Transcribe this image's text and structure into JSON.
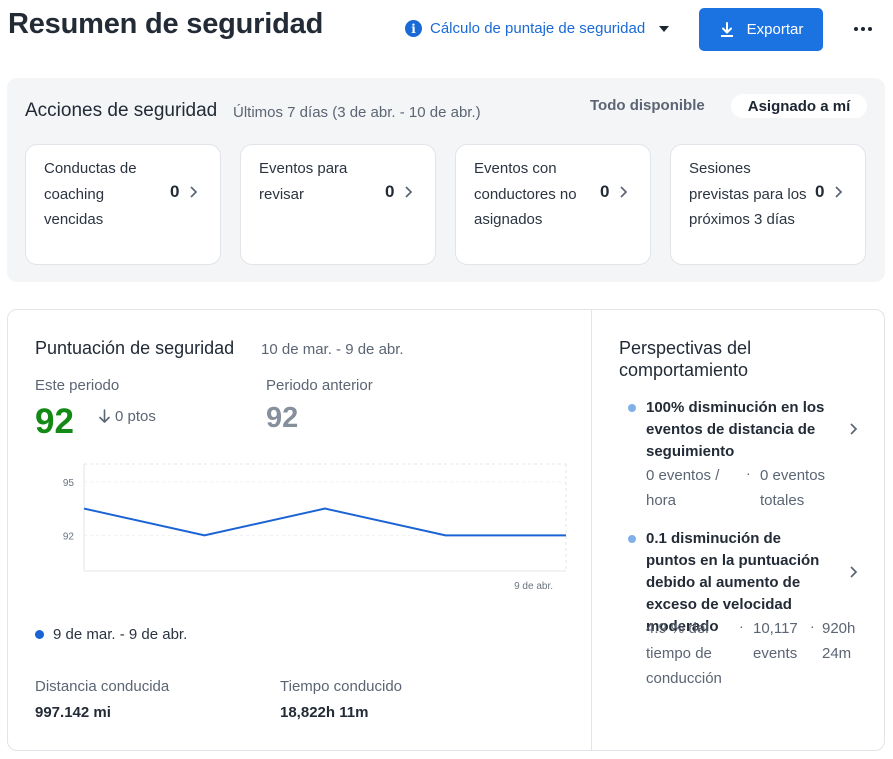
{
  "header": {
    "title": "Resumen de seguridad",
    "score_calc_label": "Cálculo de puntaje de seguridad",
    "export_label": "Exportar",
    "icons": {
      "info": "info-icon",
      "caret": "caret-down-icon",
      "export": "download-icon",
      "more": "more-horizontal-icon"
    }
  },
  "actions": {
    "title": "Acciones de seguridad",
    "range": "Últimos 7 días (3 de abr. - 10 de abr.)",
    "filter_all": "Todo disponible",
    "filter_mine": "Asignado a mí",
    "cards": [
      {
        "label": "Conductas de coaching vencidas",
        "count": "0"
      },
      {
        "label": "Eventos para revisar",
        "count": "0"
      },
      {
        "label": "Eventos con conductores no asignados",
        "count": "0"
      },
      {
        "label": "Sesiones previstas para los próximos 3 días",
        "count": "0"
      }
    ]
  },
  "score": {
    "title": "Puntuación de seguridad",
    "range": "10 de mar. - 9 de abr.",
    "this_period_label": "Este periodo",
    "this_period_value": "92",
    "delta": "0 ptos",
    "prev_period_label": "Periodo anterior",
    "prev_period_value": "92",
    "legend": "9 de mar. - 9 de abr.",
    "distance_label": "Distancia conducida",
    "distance_value": "997.142 mi",
    "time_label": "Tiempo conducido",
    "time_value": "18,822h 11m",
    "colors": {
      "score_good": "#148a16",
      "score_prev": "#86909c",
      "line": "#1a63d4"
    }
  },
  "chart_data": {
    "type": "line",
    "y_ticks": [
      "95",
      "92"
    ],
    "x_tick_labels": [
      "9 de abr."
    ],
    "ylim": [
      90,
      96
    ],
    "series": [
      {
        "name": "9 de mar. - 9 de abr.",
        "values": [
          93.5,
          92,
          93.5,
          92,
          92
        ]
      }
    ]
  },
  "insights": {
    "title": "Perspectivas del comportamiento",
    "items": [
      {
        "text": "100% disminución en los eventos de distancia de seguimiento",
        "metrics": [
          "0 eventos / hora",
          "0 eventos totales"
        ]
      },
      {
        "text": "0.1 disminución de puntos en la puntuación debido al aumento de exceso de velocidad moderado",
        "metrics": [
          "4.9 % del tiempo de conducción",
          "10,117 events",
          "920h 24m"
        ]
      }
    ]
  }
}
